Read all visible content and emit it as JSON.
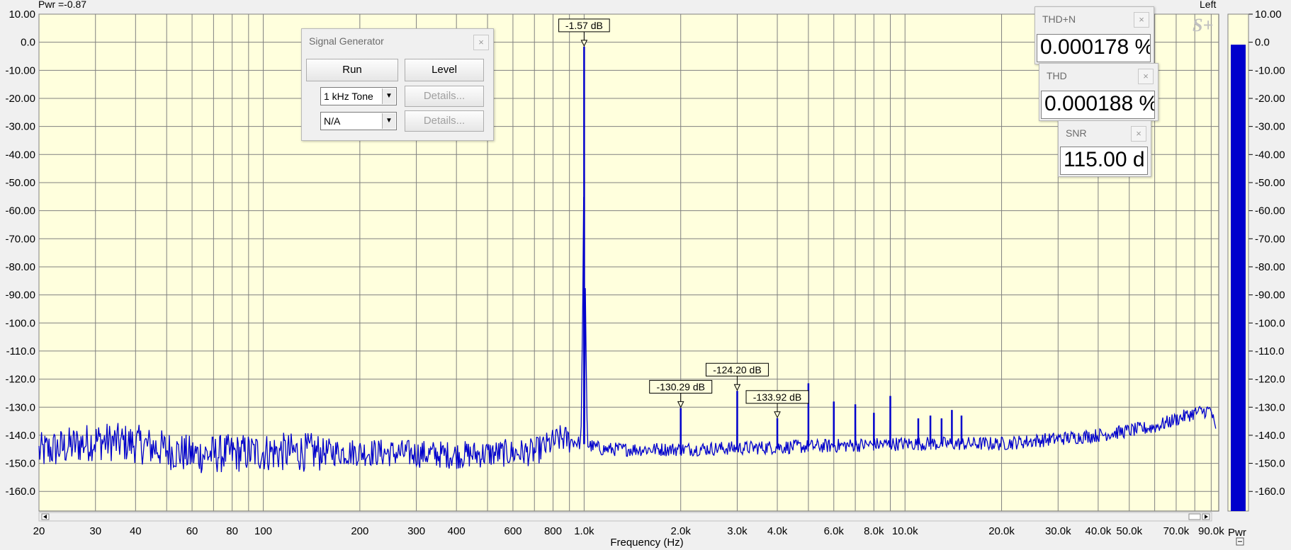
{
  "top_left_label": "Pwr =-0.87",
  "top_right_label": "Left",
  "logo_text": "S+",
  "colors": {
    "plot_bg": "#ffffdd",
    "grid": "#808080",
    "trace": "#0000cc",
    "meter": "#0000cc"
  },
  "signal_generator": {
    "title": "Signal Generator",
    "run_label": "Run",
    "level_label": "Level",
    "source1": "1 kHz Tone",
    "source2": "N/A",
    "details1_label": "Details...",
    "details2_label": "Details..."
  },
  "thdn_panel": {
    "title": "THD+N",
    "value": "0.000178 %"
  },
  "thd_panel": {
    "title": "THD",
    "value": "0.000188 %"
  },
  "snr_panel": {
    "title": "SNR",
    "value": "115.00 d"
  },
  "meter": {
    "level_db": -0.87
  },
  "chart_data": {
    "type": "line",
    "title": "",
    "xlabel": "Frequency (Hz)",
    "ylabel": "",
    "xscale": "log",
    "xlim": [
      20,
      95000
    ],
    "ylim": [
      -167,
      10
    ],
    "yticks": [
      10,
      0,
      -10,
      -20,
      -30,
      -40,
      -50,
      -60,
      -70,
      -80,
      -90,
      -100,
      -110,
      -120,
      -130,
      -140,
      -150,
      -160
    ],
    "ytick_labels": [
      "10.00",
      "0.0",
      "-10.00",
      "-20.00",
      "-30.00",
      "-40.00",
      "-50.00",
      "-60.00",
      "-70.00",
      "-80.00",
      "-90.00",
      "-100.0",
      "-110.0",
      "-120.0",
      "-130.0",
      "-140.0",
      "-150.0",
      "-160.0"
    ],
    "right_tick_labels": [
      "10.00",
      "0.0",
      "-10.00",
      "-20.00",
      "-30.00",
      "-40.00",
      "-50.00",
      "-60.00",
      "-70.00",
      "-80.00",
      "-90.00",
      "-100.0",
      "-110.0",
      "-120.0",
      "-130.0",
      "-140.0",
      "-150.0",
      "-160.0"
    ],
    "right_axis_label": "Pwr",
    "xticks": [
      {
        "x": 20,
        "label": "20"
      },
      {
        "x": 30,
        "label": "30"
      },
      {
        "x": 40,
        "label": "40"
      },
      {
        "x": 60,
        "label": "60"
      },
      {
        "x": 80,
        "label": "80"
      },
      {
        "x": 100,
        "label": "100"
      },
      {
        "x": 200,
        "label": "200"
      },
      {
        "x": 300,
        "label": "300"
      },
      {
        "x": 400,
        "label": "400"
      },
      {
        "x": 600,
        "label": "600"
      },
      {
        "x": 800,
        "label": "800"
      },
      {
        "x": 1000,
        "label": "1.0k"
      },
      {
        "x": 2000,
        "label": "2.0k"
      },
      {
        "x": 3000,
        "label": "3.0k"
      },
      {
        "x": 4000,
        "label": "4.0k"
      },
      {
        "x": 6000,
        "label": "6.0k"
      },
      {
        "x": 8000,
        "label": "8.0k"
      },
      {
        "x": 10000,
        "label": "10.0k"
      },
      {
        "x": 20000,
        "label": "20.0k"
      },
      {
        "x": 30000,
        "label": "30.0k"
      },
      {
        "x": 40000,
        "label": "40.0k"
      },
      {
        "x": 50000,
        "label": "50.0k"
      },
      {
        "x": 70000,
        "label": "70.0k"
      },
      {
        "x": 90000,
        "label": "90.0k"
      }
    ],
    "grid_x": [
      20,
      30,
      40,
      50,
      60,
      70,
      80,
      90,
      100,
      200,
      300,
      400,
      500,
      600,
      700,
      800,
      900,
      1000,
      2000,
      3000,
      4000,
      5000,
      6000,
      7000,
      8000,
      9000,
      10000,
      20000,
      30000,
      40000,
      50000,
      60000,
      70000,
      80000,
      90000
    ],
    "grid": true,
    "series": [
      {
        "color": "#0000cc",
        "noise_floor": [
          [
            20,
            -146
          ],
          [
            30,
            -142
          ],
          [
            40,
            -143
          ],
          [
            60,
            -147
          ],
          [
            100,
            -146
          ],
          [
            200,
            -146
          ],
          [
            400,
            -147
          ],
          [
            700,
            -146
          ],
          [
            850,
            -141
          ],
          [
            1150,
            -145
          ],
          [
            2000,
            -145
          ],
          [
            5000,
            -144
          ],
          [
            10000,
            -143
          ],
          [
            20000,
            -143
          ],
          [
            40000,
            -140
          ],
          [
            60000,
            -137
          ],
          [
            80000,
            -132
          ],
          [
            90000,
            -131
          ],
          [
            93000,
            -139
          ]
        ],
        "peaks": [
          {
            "x": 1000,
            "y": -1.57
          },
          {
            "x": 2000,
            "y": -130.29
          },
          {
            "x": 3000,
            "y": -124.2
          },
          {
            "x": 4000,
            "y": -133.92
          },
          {
            "x": 5000,
            "y": -121.5
          },
          {
            "x": 6000,
            "y": -128
          },
          {
            "x": 7000,
            "y": -129
          },
          {
            "x": 8000,
            "y": -132
          },
          {
            "x": 9000,
            "y": -126
          },
          {
            "x": 11000,
            "y": -134
          },
          {
            "x": 12000,
            "y": -133
          },
          {
            "x": 13000,
            "y": -134
          },
          {
            "x": 14000,
            "y": -131
          },
          {
            "x": 15000,
            "y": -133
          }
        ]
      }
    ],
    "markers": [
      {
        "x": 1000,
        "y": -1.57,
        "label": "-1.57 dB"
      },
      {
        "x": 2000,
        "y": -130.29,
        "label": "-130.29 dB"
      },
      {
        "x": 3000,
        "y": -124.2,
        "label": "-124.20 dB"
      },
      {
        "x": 4000,
        "y": -133.92,
        "label": "-133.92 dB"
      }
    ]
  }
}
